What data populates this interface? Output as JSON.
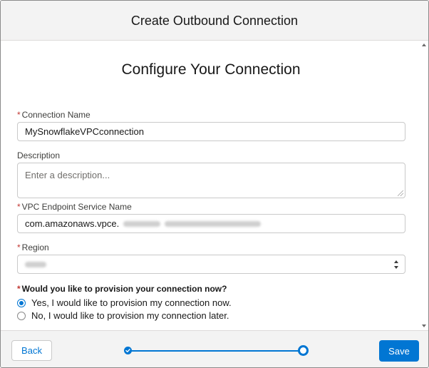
{
  "modal": {
    "title": "Create Outbound Connection"
  },
  "form": {
    "heading": "Configure Your Connection",
    "required_marker": "*",
    "connection_name": {
      "label": "Connection Name",
      "value": "MySnowflakeVPCconnection"
    },
    "description": {
      "label": "Description",
      "placeholder": "Enter a description..."
    },
    "vpc_endpoint": {
      "label": "VPC Endpoint Service Name",
      "value": "com.amazonaws.vpce."
    },
    "region": {
      "label": "Region"
    },
    "provision": {
      "question": "Would you like to provision your connection now?",
      "options": [
        {
          "label": "Yes, I would like to provision my connection now.",
          "checked": true
        },
        {
          "label": "No, I would like to provision my connection later.",
          "checked": false
        }
      ]
    }
  },
  "footer": {
    "back_label": "Back",
    "save_label": "Save",
    "progress": {
      "total_steps": 2,
      "current_step": 2
    }
  },
  "colors": {
    "accent": "#0176d3",
    "required": "#c23934"
  },
  "icons": {
    "step_complete": "check-icon",
    "step_current": "ring-icon",
    "select": "updown-chevron-icon"
  }
}
